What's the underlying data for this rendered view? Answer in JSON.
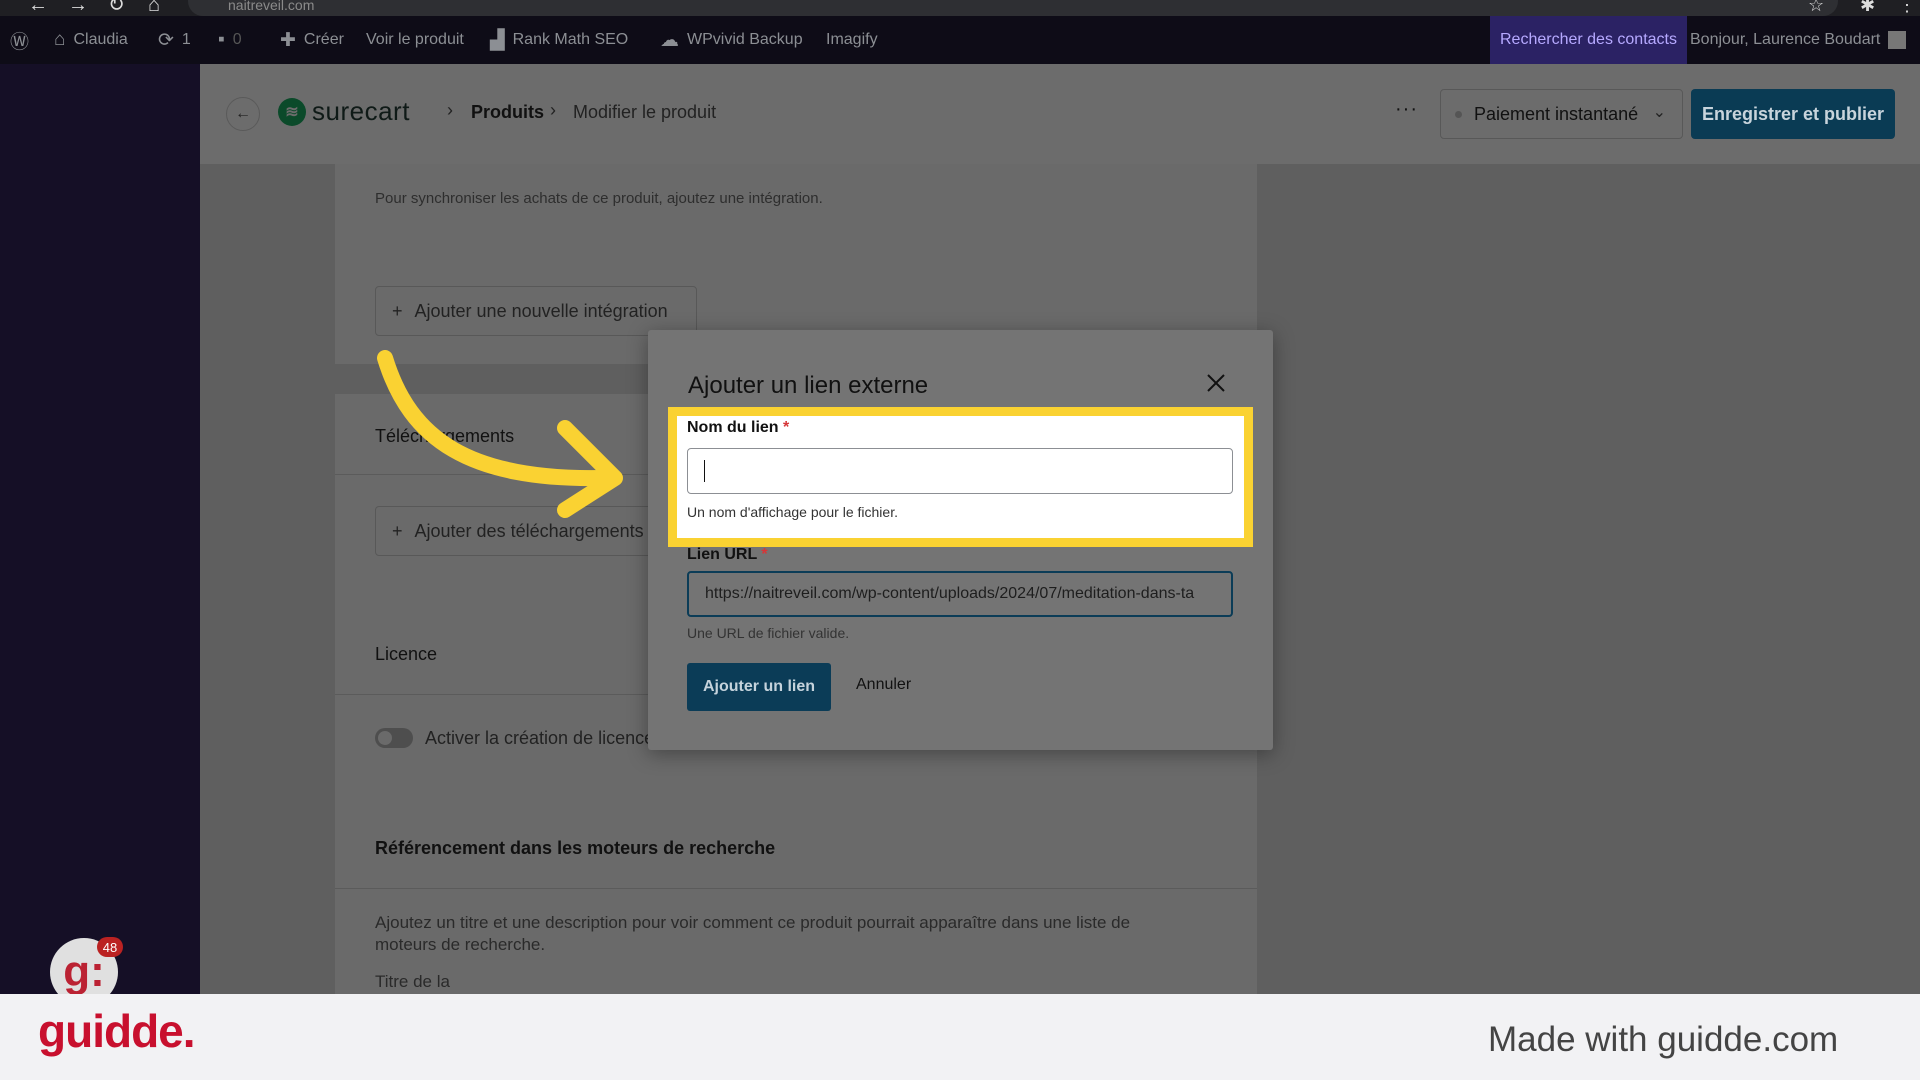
{
  "browser": {
    "url": "naitreveil.com"
  },
  "adminbar": {
    "site_name": "Claudia",
    "updates_count": "1",
    "comments_count": "0",
    "create_label": "Créer",
    "view_product_label": "Voir le produit",
    "rank_math_label": "Rank Math SEO",
    "wpvivid_label": "WPvivid Backup",
    "imagify_label": "Imagify",
    "search_contacts_label": "Rechercher des contacts",
    "greeting": "Bonjour, Laurence Boudart"
  },
  "header": {
    "brand": "surecart",
    "breadcrumb_products": "Produits",
    "breadcrumb_current": "Modifier le produit",
    "more_label": "···",
    "payment_select": "Paiement instantané",
    "publish_label": "Enregistrer et publier"
  },
  "content": {
    "integration_text": "Pour synchroniser les achats de ce produit, ajoutez une intégration.",
    "add_integration_label": "Ajouter une nouvelle intégration",
    "downloads_title": "Téléchargements",
    "add_downloads_label": "Ajouter des téléchargements",
    "license_title": "Licence",
    "license_toggle_label": "Activer la création de licence",
    "seo_title": "Référencement dans les moteurs de recherche",
    "seo_text": "Ajoutez un titre et une description pour voir comment ce produit pourrait apparaître dans une liste de moteurs de recherche.",
    "seo_partial_label": "Titre de la"
  },
  "modal": {
    "title": "Ajouter un lien externe",
    "name_label": "Nom du lien",
    "required_mark": "*",
    "name_value": "",
    "name_help": "Un nom d'affichage pour le fichier.",
    "url_label": "Lien URL",
    "url_value": "https://naitreveil.com/wp-content/uploads/2024/07/meditation-dans-ta",
    "url_help": "Une URL de fichier valide.",
    "add_link_label": "Ajouter un lien",
    "cancel_label": "Annuler"
  },
  "overlay": {
    "highlight_color": "#fad232",
    "avatar_letter": "g:",
    "avatar_badge": "48"
  },
  "footer": {
    "logo_text": "guidde.",
    "made_with": "Made with guidde.com"
  }
}
